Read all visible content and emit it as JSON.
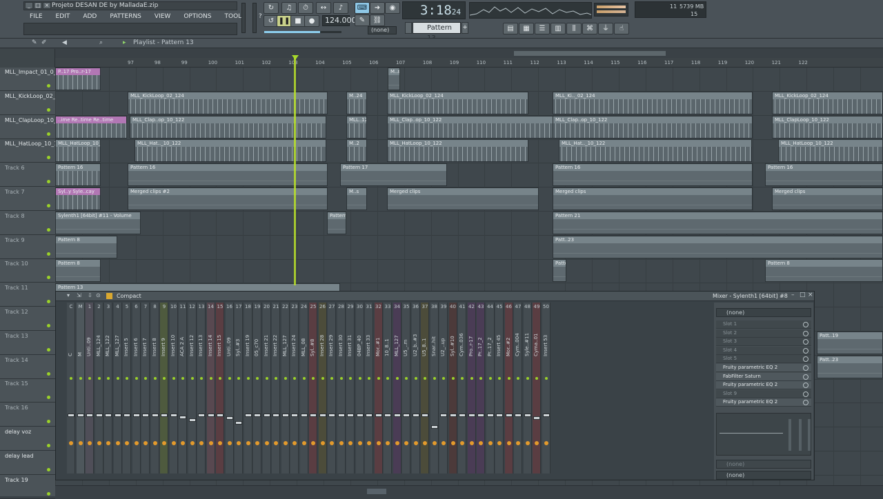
{
  "window": {
    "title": "Projeto DESAN DE by MalladaE.zip"
  },
  "menu": [
    "FILE",
    "EDIT",
    "ADD",
    "PATTERNS",
    "VIEW",
    "OPTIONS",
    "TOOLS",
    "?"
  ],
  "transport": {
    "time_main": "3:18",
    "time_sub": "24",
    "tempo": "124.000",
    "pattern": "Pattern 13",
    "pattern_none": "(none)",
    "memory": "5739 MB",
    "cpu_a": "11",
    "cpu_b": "15"
  },
  "playlist": {
    "title": "Playlist - Pattern 13",
    "ruler": [
      "97",
      "98",
      "99",
      "100",
      "101",
      "102",
      "103",
      "104",
      "105",
      "106",
      "107",
      "108",
      "109",
      "110",
      "111",
      "112",
      "113",
      "114",
      "115",
      "116",
      "117",
      "118",
      "119",
      "120",
      "121",
      "122"
    ],
    "tracks": [
      "MLL_Impact_01_0_127",
      "MLL_KickLoop_02_124",
      "MLL_ClapLoop_10_122",
      "MLL_HatLoop_10_122",
      "Track 6",
      "Track 7",
      "Track 8",
      "Track 9",
      "Track 10",
      "Track 11",
      "Track 12",
      "Track 13",
      "Track 14",
      "Track 15",
      "Track 16",
      "delay voz",
      "delay lead",
      "Track 19"
    ],
    "clips": {
      "impact": "P..17 Pro..r-17",
      "kick": "MLL_KickLoop_02_124",
      "kick_short": "M..24",
      "kick_mid": "MLL_Ki.._02_124",
      "clap": "MLL_ClapLoop_10_122",
      "clap_a": "MLL_Clap..op_10_122",
      "clap_short": "MLL..122",
      "clap_pre": "..ime Re..time Re..time",
      "hat": "MLL_HatLoop_10_122",
      "hat_a": "MLL_Hat.._10_122",
      "hat_short": "M..2",
      "p16": "Pattern 16",
      "p17": "Pattern 17",
      "merged": "Merged clips",
      "merged2": "Merged clips #2",
      "syl_a": "Syl..y Syle..cay",
      "synth": "Sylenth1 [64bit] #11 - Volume",
      "p21": "Pattern 21",
      "p23": "Patt..23",
      "p8": "Pattern 8",
      "p24": "Pattern 24",
      "p13": "Pattern 13",
      "p19": "Patt..19",
      "ms": "M..s"
    }
  },
  "mixer": {
    "mode": "Compact",
    "title": "Mixer - Sylenth1 [64bit] #8",
    "insert_select": "(none)",
    "output_select": "(none)",
    "channel_names": [
      "C",
      "M",
      "Unti..09",
      "MLL_124",
      "MLL_122",
      "MLL_127",
      "Insert 5",
      "Insert 6",
      "Insert 7",
      "Insert 8",
      "Insert 9",
      "Insert 10",
      "ACA 2 A",
      "Insert 12",
      "Insert 13",
      "Insert 14",
      "Insert 15",
      "Unti..09",
      "Syl..#3",
      "Insert 19",
      "05_c70",
      "Insert 21",
      "Insert 22",
      "MLL_127",
      "Insert 24",
      "MLL_08",
      "Syl..#8",
      "Insert 28",
      "Insert 29",
      "Insert 30",
      "Insert 31",
      "04BP_40",
      "Insert 33",
      "Mor..#1",
      "10_8..1",
      "MLL_127",
      "U5_..m",
      "U2_b..#3",
      "U5_8..1",
      "Snar..hit",
      "U2_..up",
      "Syl..#10",
      "Cym..036",
      "Pro..r-17",
      "Pr..17_2",
      "Pr..17_2",
      "Insert 45",
      "Mor..#2",
      "Cym..004",
      "Syle..#11",
      "Cyma..01",
      "Insert 53"
    ],
    "slots": [
      "Slot 1",
      "Slot 2",
      "Slot 3",
      "Slot 4",
      "Slot 5",
      "Fruity parametric EQ 2",
      "FabFilter Saturn",
      "Fruity parametric EQ 2",
      "Slot 9",
      "Fruity parametric EQ 2"
    ],
    "slot_none": "(none)"
  }
}
